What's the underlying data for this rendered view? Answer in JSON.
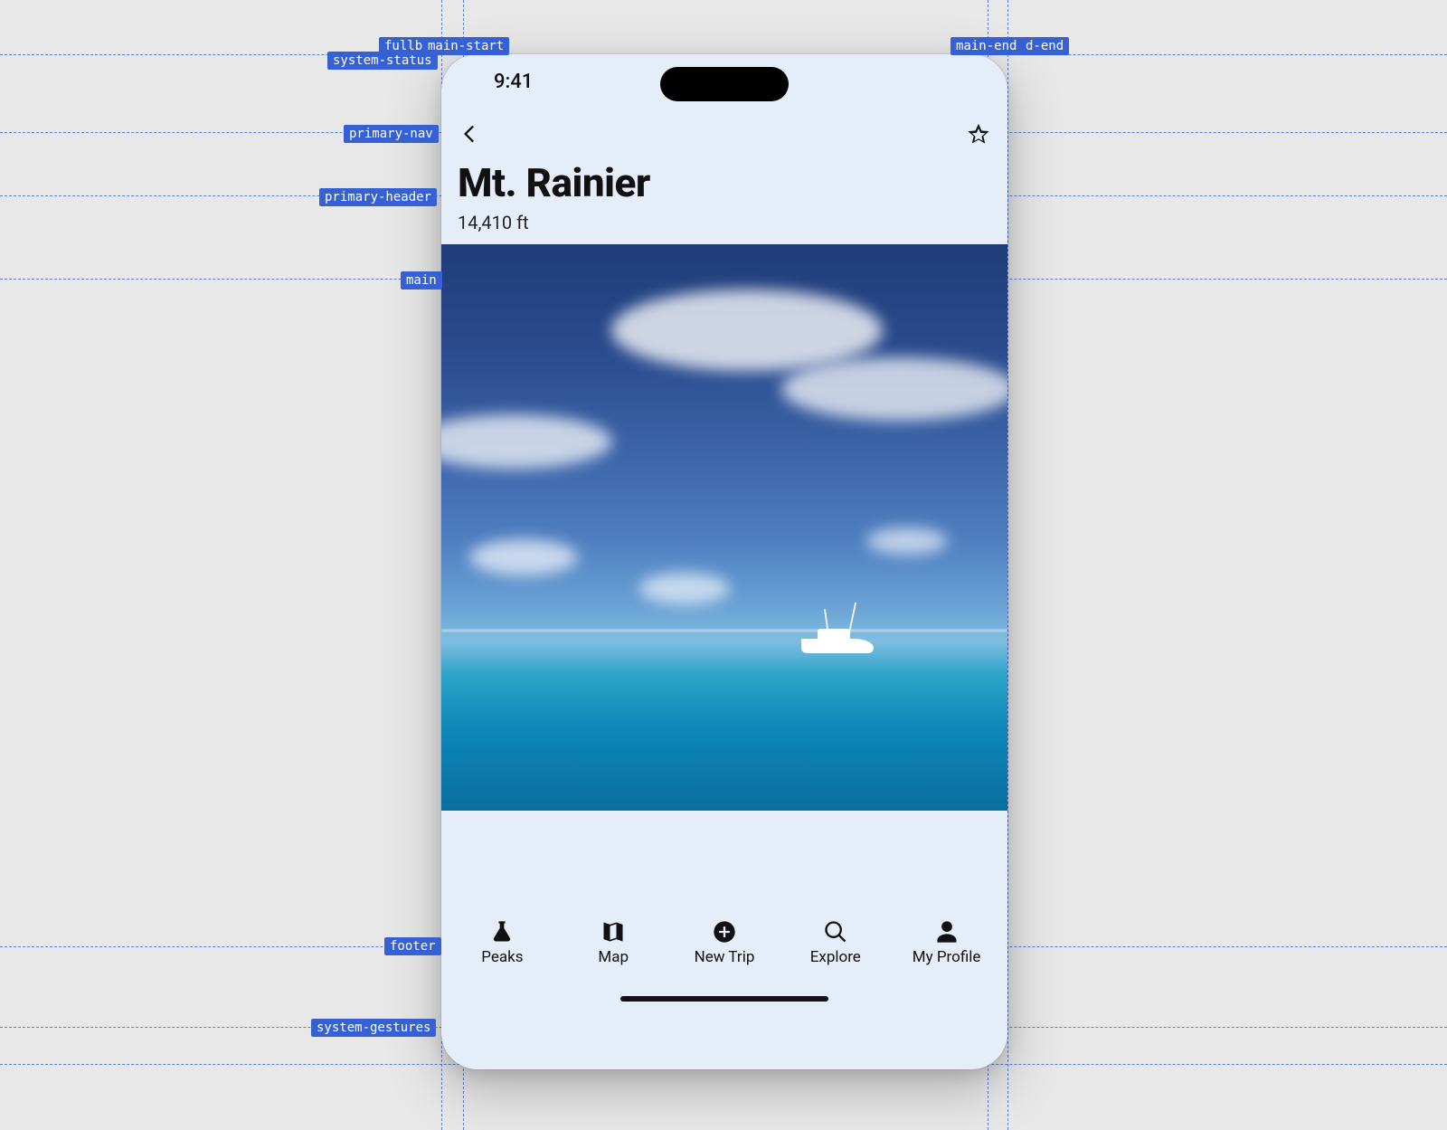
{
  "guides": {
    "fullbleed": "fullbleed",
    "main_start": "main-start",
    "main_end": "main-end",
    "fd_end": "d-end",
    "system_status": "system-status",
    "primary_nav": "primary-nav",
    "primary_header": "primary-header",
    "main": "main",
    "footer": "footer",
    "system_gestures": "system-gestures"
  },
  "status": {
    "time": "9:41"
  },
  "header": {
    "title": "Mt. Rainier",
    "subtitle": "14,410 ft"
  },
  "tabs": {
    "peaks": "Peaks",
    "map": "Map",
    "new_trip": "New Trip",
    "explore": "Explore",
    "profile": "My Profile"
  }
}
